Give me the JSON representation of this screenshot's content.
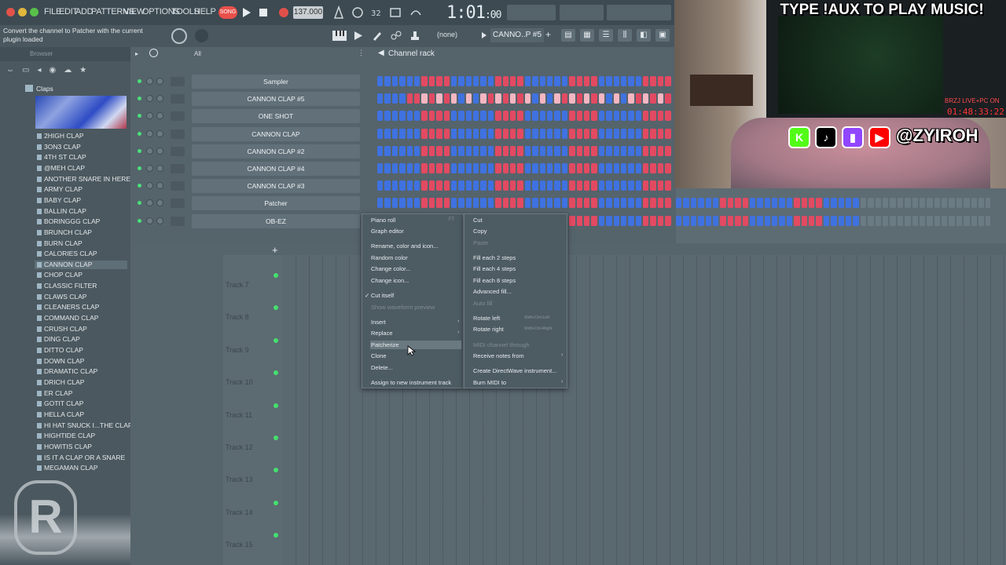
{
  "menubar": {
    "items": [
      "FILE",
      "EDIT",
      "ADD",
      "PATTERNS",
      "VIEW",
      "OPTIONS",
      "TOOLS",
      "HELP"
    ],
    "song_label": "SONG",
    "bpm": "137.000",
    "time": "1:01",
    "time_sub": ":00"
  },
  "toolbar": {
    "hint": "Convert the channel to Patcher with the current plugin loaded",
    "none_label": "(none)",
    "pattern": "CANNO..P #5"
  },
  "browser": {
    "title": "Browser",
    "folder": "Claps",
    "items": [
      "2HIGH CLAP",
      "3ON3 CLAP",
      "4TH ST CLAP",
      "@MEH CLAP",
      "ANOTHER SNARE IN HERE LOL",
      "ARMY CLAP",
      "BABY CLAP",
      "BALLIN CLAP",
      "BORINGGG CLAP",
      "BRUNCH CLAP",
      "BURN CLAP",
      "CALORIES CLAP",
      "CANNON CLAP",
      "CHOP CLAP",
      "CLASSIC FILTER",
      "CLAWS CLAP",
      "CLEANERS CLAP",
      "COMMAND CLAP",
      "CRUSH CLAP",
      "DING CLAP",
      "DITTO CLAP",
      "DOWN CLAP",
      "DRAMATIC CLAP",
      "DRICH CLAP",
      "ER CLAP",
      "GOTIT CLAP",
      "HELLA CLAP",
      "HI HAT SNUCK I...THE CLAP FOLDER",
      "HIGHTIDE CLAP",
      "HOWITIS CLAP",
      "IS IT A CLAP OR A SNARE",
      "MEGAMAN CLAP"
    ]
  },
  "rack": {
    "title": "Channel rack",
    "filter": "All",
    "channels": [
      "Sampler",
      "CANNON CLAP #5",
      "ONE SHOT",
      "CANNON CLAP",
      "CANNON CLAP #2",
      "CANNON CLAP #4",
      "CANNON CLAP #3",
      "Patcher",
      "OB-EZ"
    ]
  },
  "playlist": {
    "tracks": [
      "Track 7",
      "Track 8",
      "Track 9",
      "Track 10",
      "Track 11",
      "Track 12",
      "Track 13",
      "Track 14",
      "Track 15"
    ]
  },
  "context_left": {
    "items": [
      {
        "label": "Piano roll",
        "shortcut": "F7",
        "disabled": false
      },
      {
        "label": "Graph editor",
        "disabled": false
      },
      {
        "label": "Rename, color and icon...",
        "disabled": false
      },
      {
        "label": "Random color",
        "disabled": false
      },
      {
        "label": "Change color...",
        "disabled": false
      },
      {
        "label": "Change icon...",
        "disabled": false
      },
      {
        "label": "Cut itself",
        "disabled": false,
        "checked": true
      },
      {
        "label": "Show waveform preview",
        "disabled": true
      },
      {
        "label": "Insert",
        "disabled": false,
        "submenu": true
      },
      {
        "label": "Replace",
        "disabled": false,
        "submenu": true
      },
      {
        "label": "Patcherize",
        "disabled": false,
        "highlighted": true
      },
      {
        "label": "Clone",
        "disabled": false
      },
      {
        "label": "Delete...",
        "disabled": false
      },
      {
        "label": "Assign to new instrument track",
        "disabled": false
      }
    ]
  },
  "context_right": {
    "items": [
      {
        "label": "Cut",
        "disabled": false
      },
      {
        "label": "Copy",
        "disabled": false
      },
      {
        "label": "Paste",
        "disabled": true
      },
      {
        "label": "Fill each 2 steps",
        "disabled": false
      },
      {
        "label": "Fill each 4 steps",
        "disabled": false
      },
      {
        "label": "Fill each 8 steps",
        "disabled": false
      },
      {
        "label": "Advanced fill...",
        "disabled": false
      },
      {
        "label": "Auto fill",
        "disabled": true
      },
      {
        "label": "Rotate left",
        "shortcut": "Shift+Ctrl+Left",
        "disabled": false
      },
      {
        "label": "Rotate right",
        "shortcut": "Shift+Ctrl+Right",
        "disabled": false
      },
      {
        "label": "MIDI channel through",
        "disabled": true
      },
      {
        "label": "Receive notes from",
        "disabled": false,
        "submenu": true
      },
      {
        "label": "Create DirectWave instrument...",
        "disabled": false
      },
      {
        "label": "Burn MIDI to",
        "disabled": false,
        "submenu": true
      }
    ]
  },
  "stream": {
    "banner": "TYPE !AUX TO PLAY MUSIC!",
    "live_label": "BRZJ LIVE+PC ON",
    "live_time": "01:48:33:22",
    "handle": "@ZYIROH",
    "socials": [
      "K",
      "♪",
      "▮",
      "▶"
    ],
    "social_colors": [
      "#53fc18",
      "#000000",
      "#9146ff",
      "#ff0000"
    ]
  },
  "colors": {
    "step_blue": "#3f72e0",
    "step_red": "#e24a62",
    "accent_green": "#49e07a"
  }
}
